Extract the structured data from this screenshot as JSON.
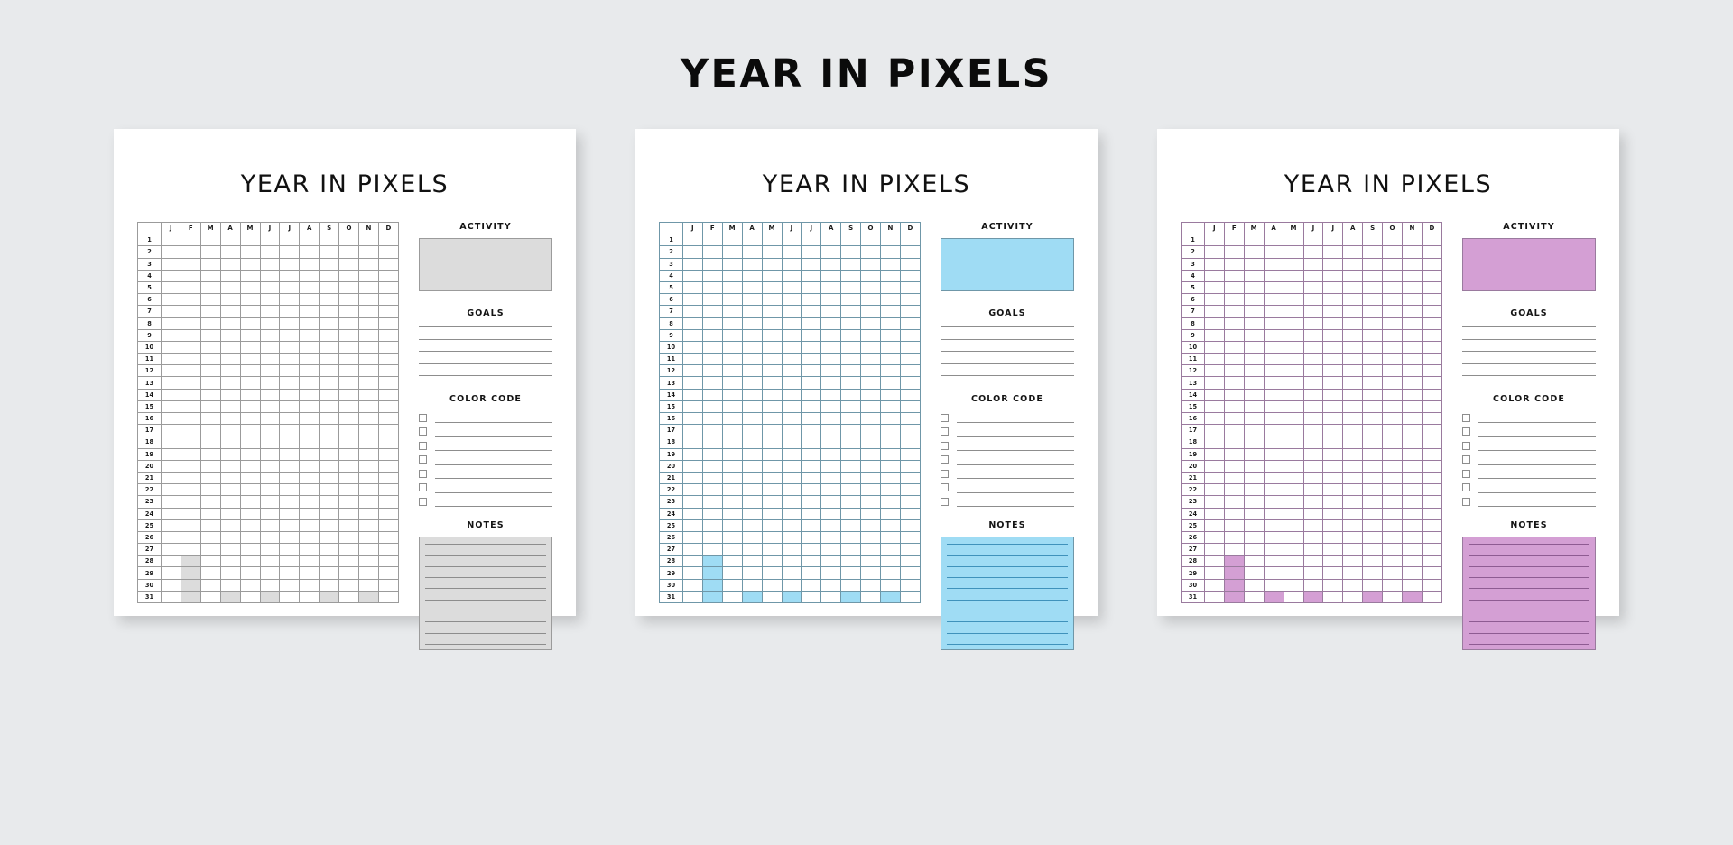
{
  "page": {
    "title": "YEAR IN PIXELS",
    "background": "#e8eaec"
  },
  "labels": {
    "card_title": "YEAR IN PIXELS",
    "activity": "ACTIVITY",
    "goals": "GOALS",
    "color_code": "COLOR CODE",
    "notes": "NOTES"
  },
  "grid": {
    "corner": "",
    "months": [
      "J",
      "F",
      "M",
      "A",
      "M",
      "J",
      "J",
      "A",
      "S",
      "O",
      "N",
      "D"
    ],
    "days": [
      1,
      2,
      3,
      4,
      5,
      6,
      7,
      8,
      9,
      10,
      11,
      12,
      13,
      14,
      15,
      16,
      17,
      18,
      19,
      20,
      21,
      22,
      23,
      24,
      25,
      26,
      27,
      28,
      29,
      30,
      31
    ],
    "filled_cells": [
      {
        "day": 28,
        "month": 2
      },
      {
        "day": 29,
        "month": 2
      },
      {
        "day": 30,
        "month": 2
      },
      {
        "day": 31,
        "month": 2
      },
      {
        "day": 31,
        "month": 4
      },
      {
        "day": 31,
        "month": 6
      },
      {
        "day": 31,
        "month": 9
      },
      {
        "day": 31,
        "month": 11
      }
    ]
  },
  "counts": {
    "goals_lines": 5,
    "color_code_rows": 7,
    "notes_lines": 10
  },
  "cards": [
    {
      "id": "card-gray",
      "theme_name": "gray",
      "fill": "#dcdcdc",
      "notes_fill": "#dcdcdc",
      "notes_line": "#8d8d8d",
      "border": "#9b9b9b",
      "cell_fill": "#dcdcdc"
    },
    {
      "id": "card-blue",
      "theme_name": "blue",
      "fill": "#9fdcf4",
      "notes_fill": "#9fdcf4",
      "notes_line": "#3f92bb",
      "border": "#6f97a8",
      "cell_fill": "#9fdcf4"
    },
    {
      "id": "card-purple",
      "theme_name": "purple",
      "fill": "#d49fd4",
      "notes_fill": "#d49fd4",
      "notes_line": "#8e5b92",
      "border": "#9a7a9e",
      "cell_fill": "#d49fd4"
    }
  ]
}
